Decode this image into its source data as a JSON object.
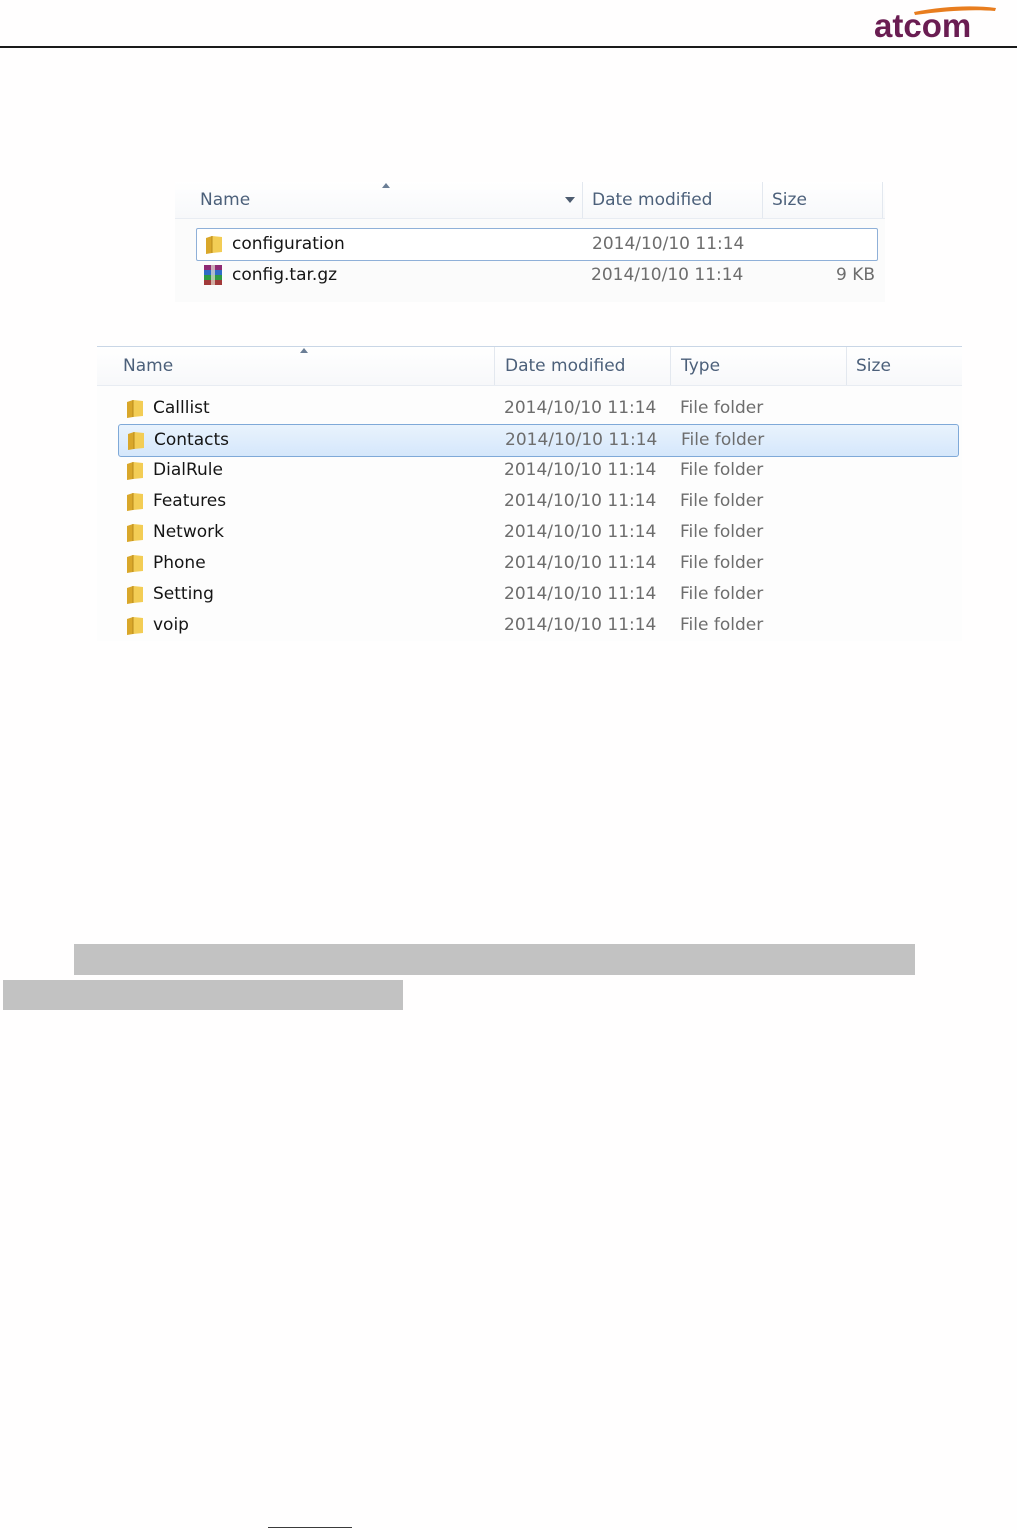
{
  "header": {
    "logo_text": "atcom",
    "brand_color": "#6a1d52",
    "accent_color": "#e87d1e"
  },
  "panel_top": {
    "columns": {
      "name": "Name",
      "date": "Date modified",
      "size": "Size"
    },
    "rows": [
      {
        "icon": "folder-icon",
        "name": "configuration",
        "date": "2014/10/10 11:14",
        "size": ""
      },
      {
        "icon": "archive-icon",
        "name": "config.tar.gz",
        "date": "2014/10/10 11:14",
        "size": "9 KB"
      }
    ]
  },
  "panel_bottom": {
    "columns": {
      "name": "Name",
      "date": "Date modified",
      "type": "Type",
      "size": "Size"
    },
    "rows": [
      {
        "name": "Calllist",
        "date": "2014/10/10 11:14",
        "type": "File folder"
      },
      {
        "name": "Contacts",
        "date": "2014/10/10 11:14",
        "type": "File folder"
      },
      {
        "name": "DialRule",
        "date": "2014/10/10 11:14",
        "type": "File folder"
      },
      {
        "name": "Features",
        "date": "2014/10/10 11:14",
        "type": "File folder"
      },
      {
        "name": "Network",
        "date": "2014/10/10 11:14",
        "type": "File folder"
      },
      {
        "name": "Phone",
        "date": "2014/10/10 11:14",
        "type": "File folder"
      },
      {
        "name": "Setting",
        "date": "2014/10/10 11:14",
        "type": "File folder"
      },
      {
        "name": "voip",
        "date": "2014/10/10 11:14",
        "type": "File folder"
      }
    ],
    "selected_row": "Contacts"
  }
}
